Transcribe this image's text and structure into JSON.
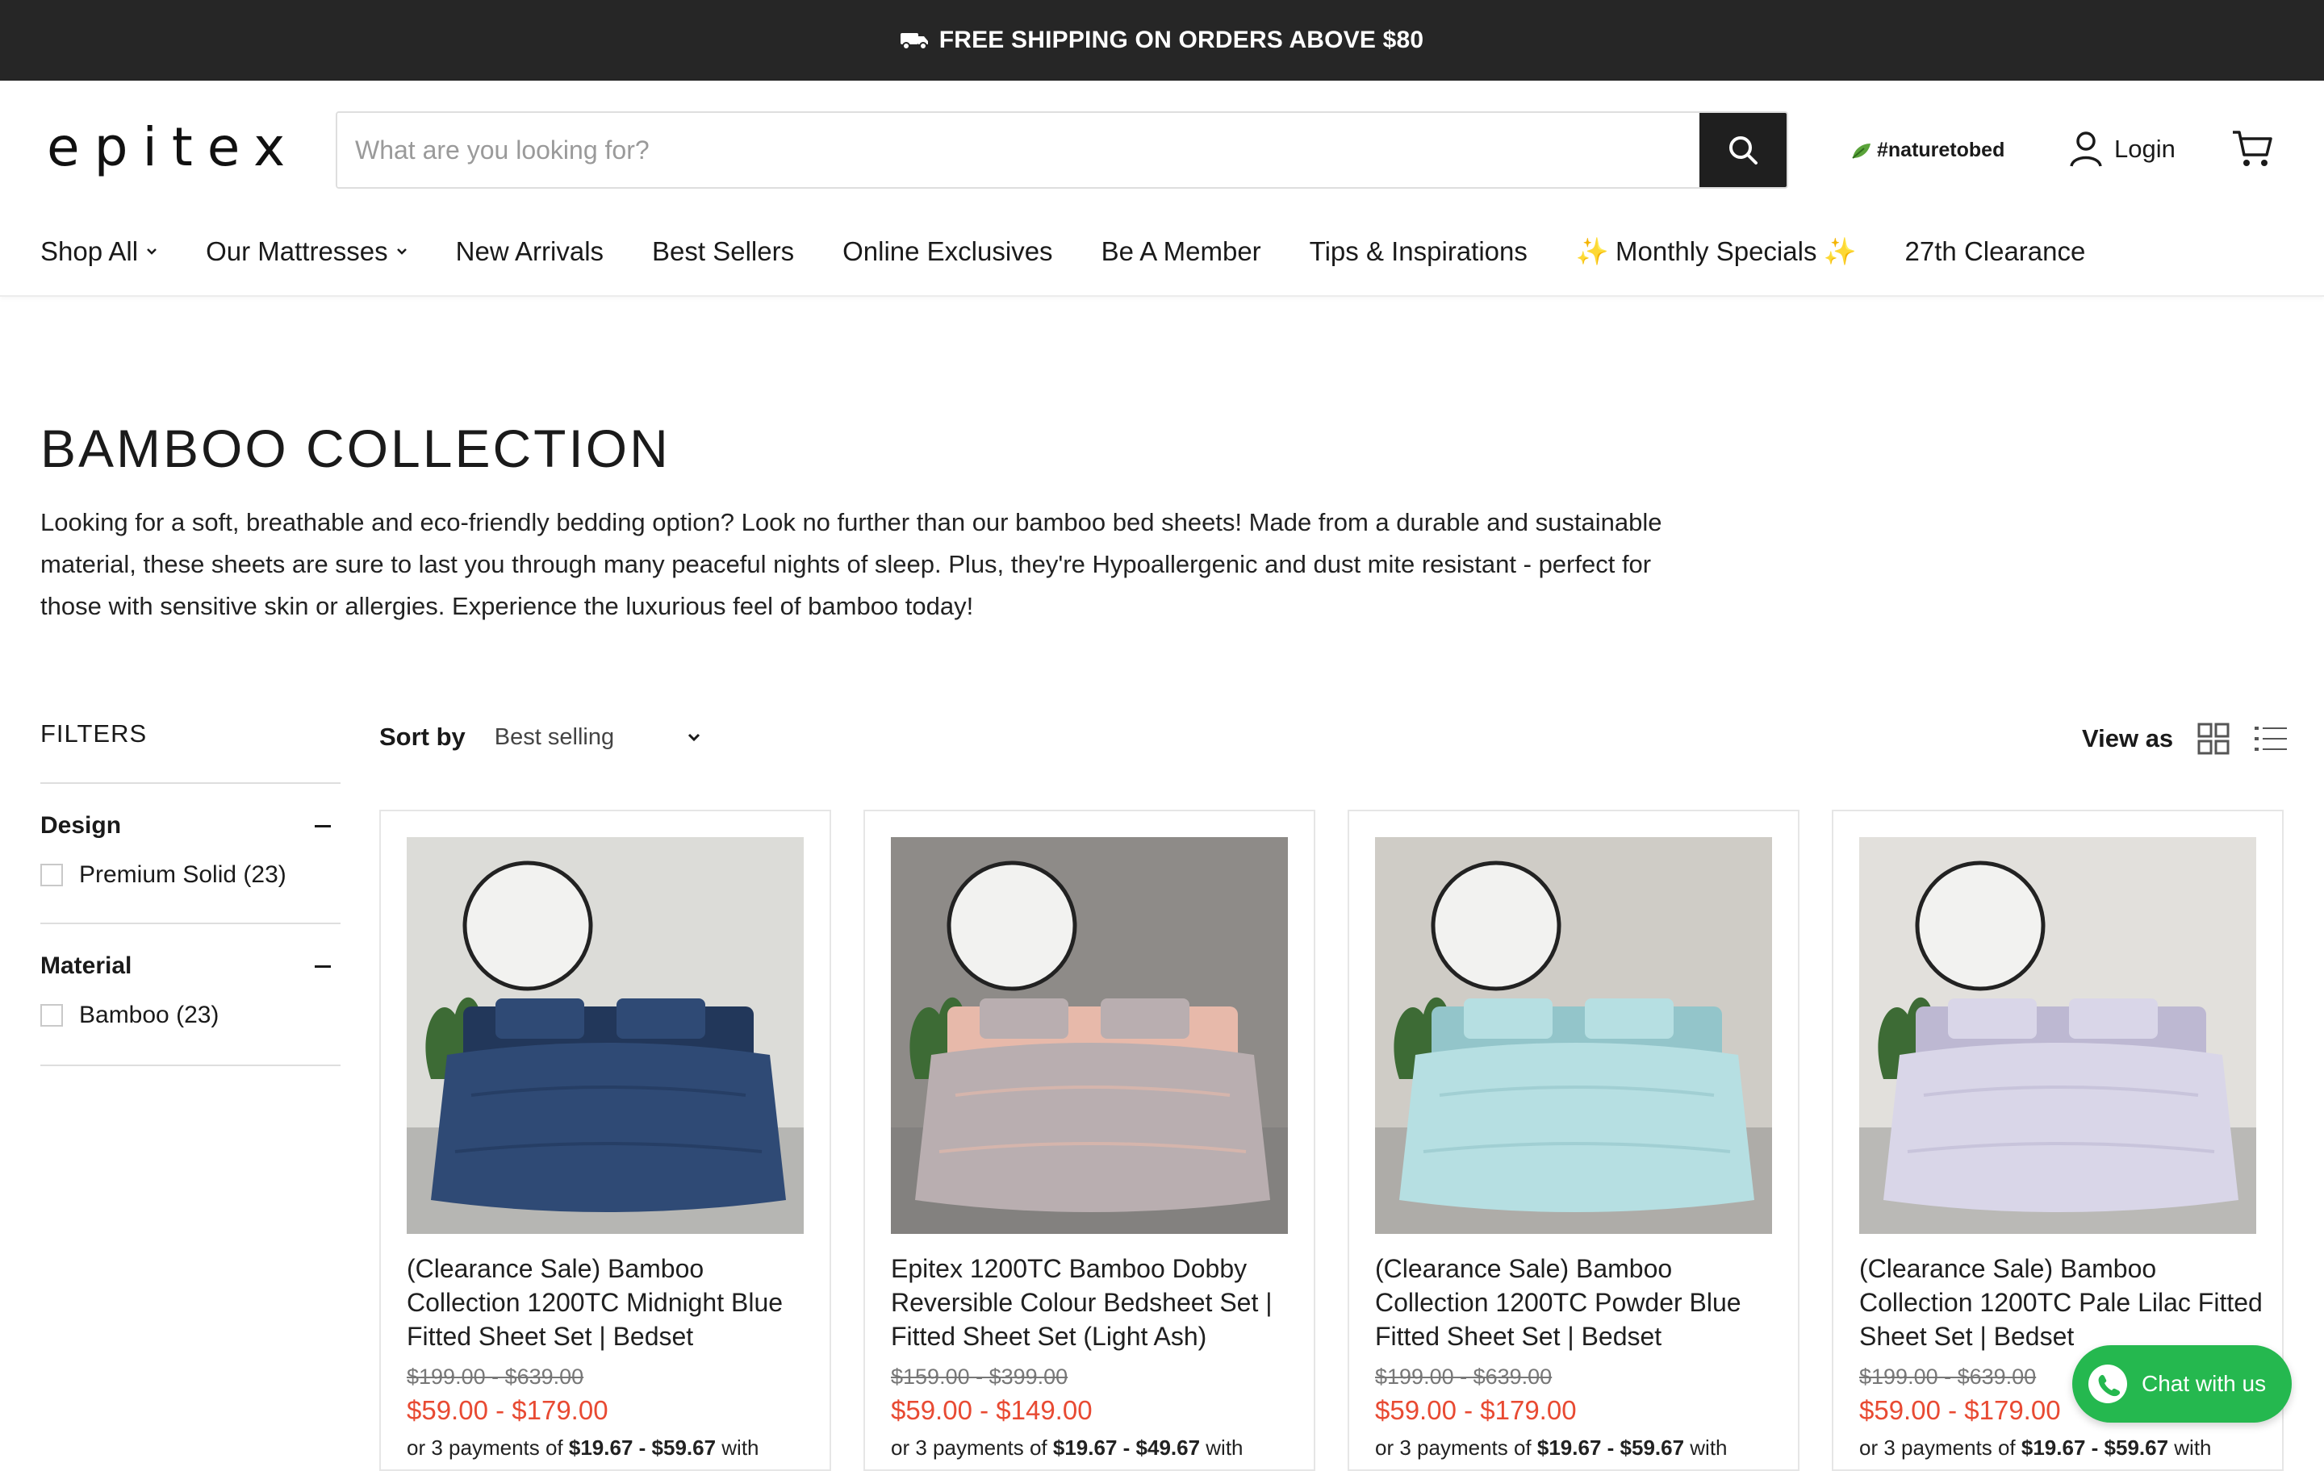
{
  "announcement": {
    "text": "FREE SHIPPING ON ORDERS ABOVE $80",
    "icon": "truck-icon"
  },
  "header": {
    "logo": "epitex",
    "search": {
      "placeholder": "What are you looking for?",
      "value": ""
    },
    "tagline": "#naturetobed",
    "login_label": "Login"
  },
  "nav": [
    {
      "label": "Shop All",
      "dropdown": true
    },
    {
      "label": "Our Mattresses",
      "dropdown": true
    },
    {
      "label": "New Arrivals",
      "dropdown": false
    },
    {
      "label": "Best Sellers",
      "dropdown": false
    },
    {
      "label": "Online Exclusives",
      "dropdown": false
    },
    {
      "label": "Be A Member",
      "dropdown": false
    },
    {
      "label": "Tips & Inspirations",
      "dropdown": false
    },
    {
      "label": "Monthly Specials",
      "dropdown": false,
      "sparkles": "✨"
    },
    {
      "label": "27th Clearance",
      "dropdown": false
    }
  ],
  "page": {
    "title": "BAMBOO COLLECTION",
    "description": "Looking for a soft, breathable and eco-friendly bedding option? Look no further than our bamboo bed sheets! Made from a durable and sustainable material, these sheets are sure to last you through many peaceful nights of sleep. Plus, they're Hypoallergenic and dust mite resistant - perfect for those with sensitive skin or allergies. Experience the luxurious feel of bamboo today!"
  },
  "filters": {
    "title": "FILTERS",
    "groups": [
      {
        "name": "Design",
        "options": [
          {
            "label": "Premium Solid (23)",
            "checked": false
          }
        ]
      },
      {
        "name": "Material",
        "options": [
          {
            "label": "Bamboo (23)",
            "checked": false
          }
        ]
      }
    ]
  },
  "sort": {
    "label": "Sort by",
    "value": "Best selling"
  },
  "view": {
    "label": "View as",
    "modes": [
      "grid-view-icon",
      "list-view-icon"
    ]
  },
  "products": [
    {
      "name": "(Clearance Sale) Bamboo Collection 1200TC Midnight Blue Fitted Sheet Set | Bedset",
      "was": "$199.00 - $639.00",
      "now": "$59.00 - $179.00",
      "install_prefix": "or 3 payments of ",
      "install_amount": "$19.67 - $59.67",
      "install_suffix": " with",
      "bed_color": "#2f4a75",
      "bed_shade": "#22375a",
      "wall": "#dcdcd8"
    },
    {
      "name": "Epitex 1200TC Bamboo Dobby Reversible Colour Bedsheet Set | Fitted Sheet Set (Light Ash)",
      "was": "$159.00 - $399.00",
      "now": "$59.00 - $149.00",
      "install_prefix": "or 3 payments of ",
      "install_amount": "$19.67 - $49.67",
      "install_suffix": " with",
      "bed_color": "#b9aeb0",
      "bed_shade": "#e7b9aa",
      "wall": "#8e8b88"
    },
    {
      "name": "(Clearance Sale) Bamboo Collection 1200TC Powder Blue Fitted Sheet Set | Bedset",
      "was": "$199.00 - $639.00",
      "now": "$59.00 - $179.00",
      "install_prefix": "or 3 payments of ",
      "install_amount": "$19.67 - $59.67",
      "install_suffix": " with",
      "bed_color": "#b6dfe2",
      "bed_shade": "#93c5ca",
      "wall": "#cfccc6"
    },
    {
      "name": "(Clearance Sale) Bamboo Collection 1200TC Pale Lilac Fitted Sheet Set | Bedset",
      "was": "$199.00 - $639.00",
      "now": "$59.00 - $179.00",
      "install_prefix": "or 3 payments of ",
      "install_amount": "$19.67 - $59.67",
      "install_suffix": " with",
      "bed_color": "#d9d6e8",
      "bed_shade": "#bdb8d2",
      "wall": "#e2e0dc"
    }
  ],
  "chat": {
    "label": "Chat with us"
  },
  "colors": {
    "topbar": "#262626",
    "sale_price": "#e84a32",
    "chat": "#25b84f"
  }
}
